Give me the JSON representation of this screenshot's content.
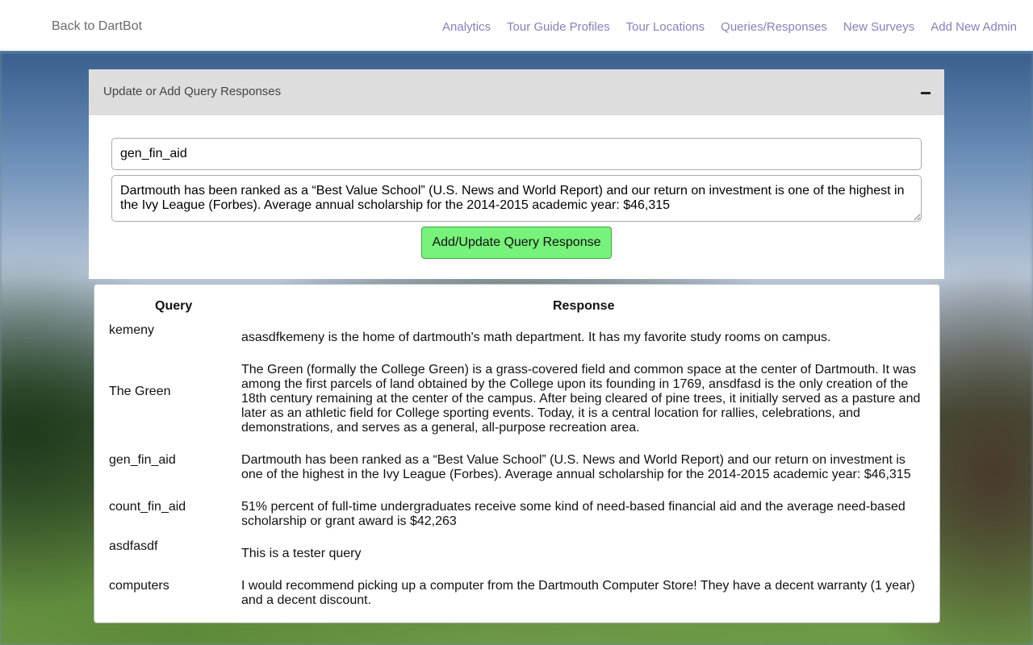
{
  "nav": {
    "back_label": "Back to DartBot",
    "links": [
      "Analytics",
      "Tour Guide Profiles",
      "Tour Locations",
      "Queries/Responses",
      "New Surveys",
      "Add New Admin"
    ]
  },
  "panel": {
    "title": "Update or Add Query Responses",
    "query_value": "gen_fin_aid",
    "response_value": "Dartmouth has been ranked as a “Best Value School” (U.S. News and World Report) and our return on investment is one of the highest in the Ivy League (Forbes). Average annual scholarship for the 2014-2015 academic year: $46,315",
    "submit_label": "Add/Update Query Response"
  },
  "table": {
    "headers": {
      "query": "Query",
      "response": "Response"
    },
    "rows": [
      {
        "query": "kemeny",
        "response": "asasdfkemeny is the home of dartmouth's math department. It has my favorite study rooms on campus."
      },
      {
        "query": "The Green",
        "response": "The Green (formally the College Green) is a grass-covered field and common space at the center of Dartmouth. It was among the first parcels of land obtained by the College upon its founding in 1769, ansdfasd is the only creation of the 18th century remaining at the center of the campus. After being cleared of pine trees, it initially served as a pasture and later as an athletic field for College sporting events. Today, it is a central location for rallies, celebrations, and demonstrations, and serves as a general, all-purpose recreation area."
      },
      {
        "query": "gen_fin_aid",
        "response": "Dartmouth has been ranked as a “Best Value School” (U.S. News and World Report) and our return on investment is one of the highest in the Ivy League (Forbes). Average annual scholarship for the 2014-2015 academic year: $46,315"
      },
      {
        "query": "count_fin_aid",
        "response": "51% percent of full-time undergraduates receive some kind of need-based financial aid and the average need-based scholarship or grant award is $42,263"
      },
      {
        "query": "asdfasdf",
        "response": "This is a tester query"
      },
      {
        "query": "computers",
        "response": "I would recommend picking up a computer from the Dartmouth Computer Store! They have a decent warranty (1 year) and a decent discount."
      }
    ]
  }
}
